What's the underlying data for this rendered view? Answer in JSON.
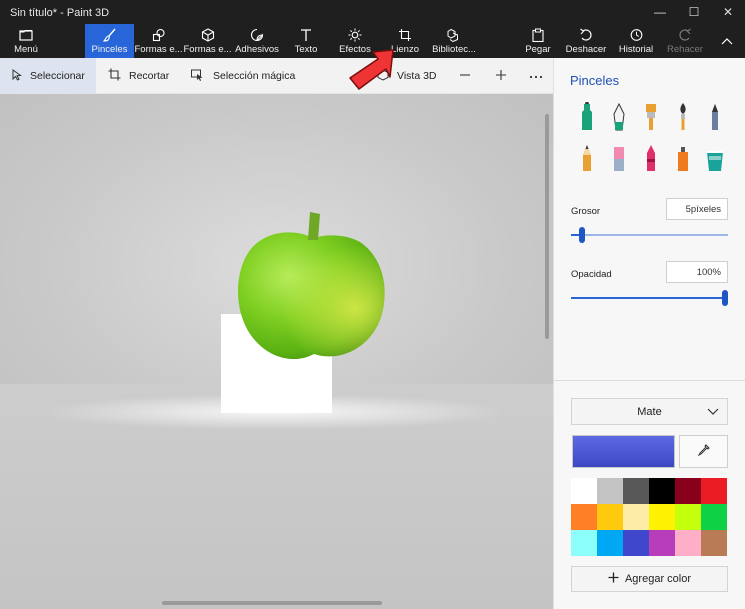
{
  "window": {
    "title": "Sin título* - Paint 3D",
    "minimize": "—",
    "maximize": "☐",
    "close": "✕"
  },
  "ribbon": {
    "menu": "Menú",
    "tools": [
      {
        "id": "brushes",
        "label": "Pinceles",
        "icon": "brush-icon",
        "active": true
      },
      {
        "id": "2d-shapes",
        "label": "Formas e...",
        "icon": "shapes-2d-icon"
      },
      {
        "id": "3d-shapes",
        "label": "Formas e...",
        "icon": "cube-icon"
      },
      {
        "id": "stickers",
        "label": "Adhesivos",
        "icon": "sticker-icon"
      },
      {
        "id": "text",
        "label": "Texto",
        "icon": "text-icon"
      },
      {
        "id": "effects",
        "label": "Efectos",
        "icon": "sun-icon"
      },
      {
        "id": "canvas",
        "label": "Lienzo",
        "icon": "canvas-crop-icon"
      },
      {
        "id": "library",
        "label": "Bibliotec...",
        "icon": "library-icon"
      }
    ],
    "paste": "Pegar",
    "undo": "Deshacer",
    "history": "Historial",
    "redo": "Rehacer"
  },
  "toolbar": {
    "select": "Seleccionar",
    "crop": "Recortar",
    "magic_select": "Selección mágica",
    "view_3d": "Vista 3D"
  },
  "panel": {
    "title": "Pinceles",
    "brushes": [
      {
        "name": "marker-icon",
        "color": "#1aa37a"
      },
      {
        "name": "calligraphy-pen-icon",
        "color": "#1aa37a"
      },
      {
        "name": "oil-brush-icon",
        "color": "#e8a030"
      },
      {
        "name": "watercolor-icon",
        "color": "#e8a030"
      },
      {
        "name": "pixel-pen-icon",
        "color": "#6a7fa0"
      },
      {
        "name": "pencil-icon",
        "color": "#e8a030"
      },
      {
        "name": "eraser-icon",
        "color": "#f08ab0"
      },
      {
        "name": "crayon-icon",
        "color": "#e0306a"
      },
      {
        "name": "spray-can-icon",
        "color": "#f07a20"
      },
      {
        "name": "fill-bucket-icon",
        "color": "#1aa39a"
      }
    ],
    "thickness_label": "Grosor",
    "thickness_value": "5píxeles",
    "thickness_level": 0.05,
    "opacity_label": "Opacidad",
    "opacity_value": "100%",
    "opacity_level": 1.0,
    "finish": "Mate",
    "current_color": "#3d48c4",
    "palette": [
      "#ffffff",
      "#c3c3c3",
      "#585858",
      "#000000",
      "#88001b",
      "#ec1c24",
      "#ff7f27",
      "#ffc90e",
      "#fdeca6",
      "#fff200",
      "#c4ff0e",
      "#0ed145",
      "#8cfffb",
      "#00a8f3",
      "#3f48cc",
      "#b83dba",
      "#ffaec8",
      "#b97a56"
    ],
    "add_color": "Agregar color"
  }
}
